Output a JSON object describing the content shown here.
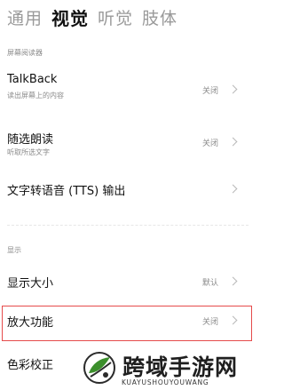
{
  "tabs": [
    {
      "label": "通用",
      "active": false
    },
    {
      "label": "视觉",
      "active": true
    },
    {
      "label": "听觉",
      "active": false
    },
    {
      "label": "肢体",
      "active": false
    }
  ],
  "screen_reader_section": {
    "label": "屏幕阅读器",
    "items": [
      {
        "title": "TalkBack",
        "subtitle": "读出屏幕上的内容",
        "value": "关闭"
      },
      {
        "title": "随选朗读",
        "subtitle": "听取所选文字",
        "value": "关闭"
      },
      {
        "title": "文字转语音 (TTS) 输出",
        "subtitle": "",
        "value": ""
      }
    ]
  },
  "display_section": {
    "label": "显示",
    "items": [
      {
        "title": "显示大小",
        "value": "默认"
      },
      {
        "title": "放大功能",
        "value": "关闭"
      },
      {
        "title": "色彩校正",
        "value": ""
      }
    ]
  },
  "watermark": {
    "title": "跨域手游网",
    "subtitle": "KUAYUSHOUYOUWANG"
  },
  "colors": {
    "highlight_border": "#e54b4b",
    "logo_green": "#3c8f2c"
  },
  "icons": [
    "chevron-right-icon",
    "watermark-logo-icon"
  ]
}
